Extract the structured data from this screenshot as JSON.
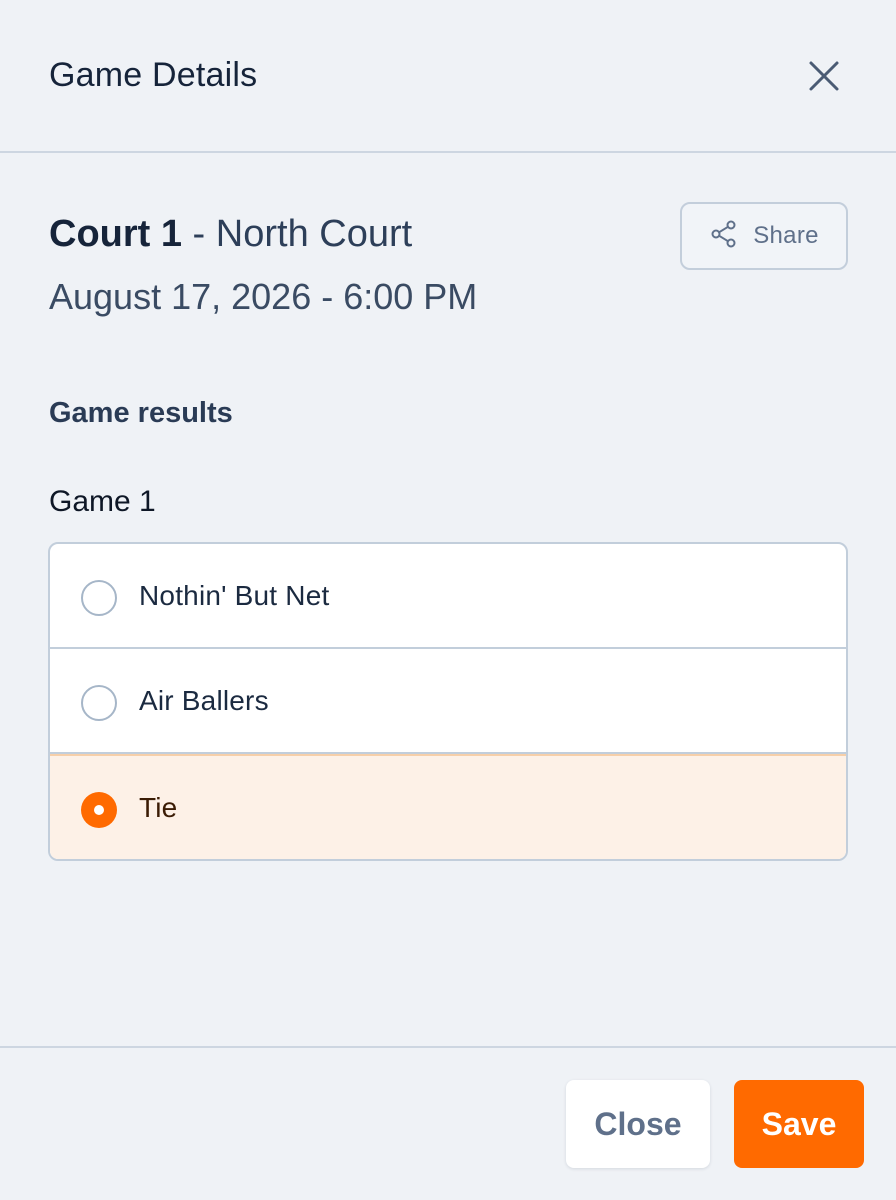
{
  "dialog": {
    "title": "Game Details"
  },
  "game": {
    "court": "Court 1",
    "separator": " - ",
    "location": "North Court",
    "datetime": "August 17, 2026 - 6:00 PM"
  },
  "share": {
    "label": "Share",
    "icon": "share-icon"
  },
  "results": {
    "heading": "Game results",
    "game_label": "Game 1",
    "options": [
      {
        "label": "Nothin' But Net",
        "selected": false
      },
      {
        "label": "Air Ballers",
        "selected": false
      },
      {
        "label": "Tie",
        "selected": true
      }
    ]
  },
  "footer": {
    "close_label": "Close",
    "save_label": "Save"
  },
  "colors": {
    "accent": "#ff6a00",
    "background": "#eff2f6",
    "selected_row": "#fdf1e7"
  }
}
